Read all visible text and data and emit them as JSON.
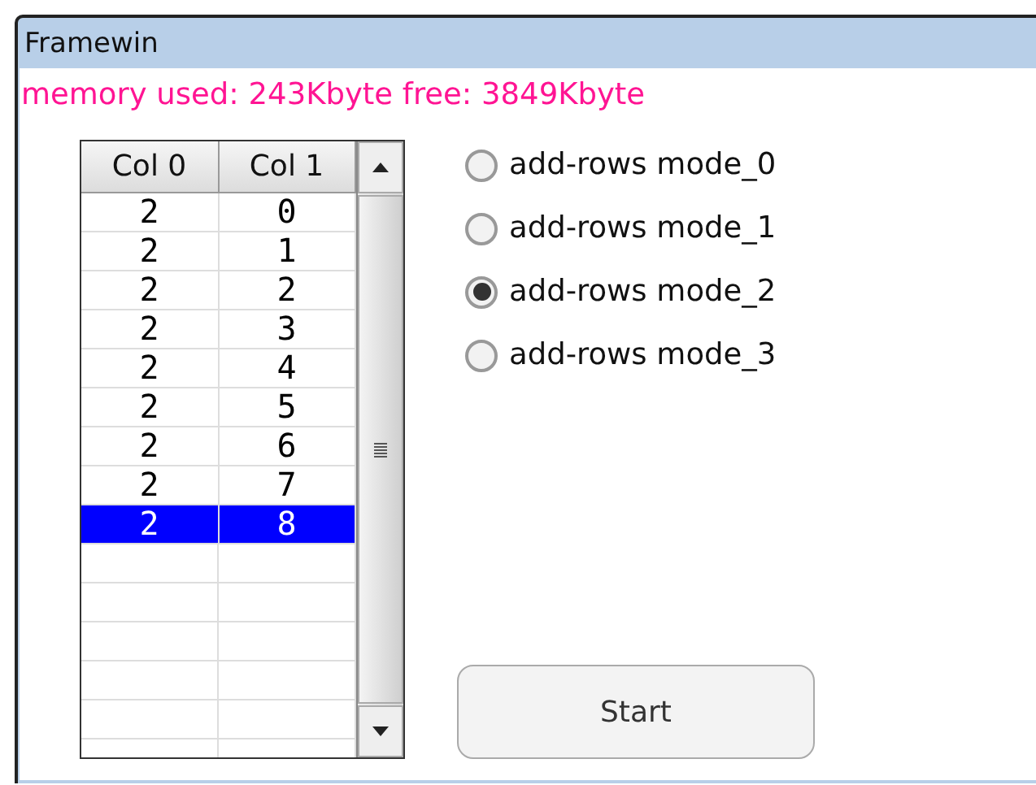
{
  "window": {
    "title": "Framewin"
  },
  "memory_text": "memory used: 243Kbyte free: 3849Kbyte",
  "table": {
    "columns": [
      "Col 0",
      "Col 1"
    ],
    "rows": [
      {
        "cells": [
          "2",
          "0"
        ],
        "selected": false
      },
      {
        "cells": [
          "2",
          "1"
        ],
        "selected": false
      },
      {
        "cells": [
          "2",
          "2"
        ],
        "selected": false
      },
      {
        "cells": [
          "2",
          "3"
        ],
        "selected": false
      },
      {
        "cells": [
          "2",
          "4"
        ],
        "selected": false
      },
      {
        "cells": [
          "2",
          "5"
        ],
        "selected": false
      },
      {
        "cells": [
          "2",
          "6"
        ],
        "selected": false
      },
      {
        "cells": [
          "2",
          "7"
        ],
        "selected": false
      },
      {
        "cells": [
          "2",
          "8"
        ],
        "selected": true
      }
    ]
  },
  "radios": [
    {
      "label": "add-rows mode_0",
      "selected": false
    },
    {
      "label": "add-rows mode_1",
      "selected": false
    },
    {
      "label": "add-rows mode_2",
      "selected": true
    },
    {
      "label": "add-rows mode_3",
      "selected": false
    }
  ],
  "start_button": "Start"
}
